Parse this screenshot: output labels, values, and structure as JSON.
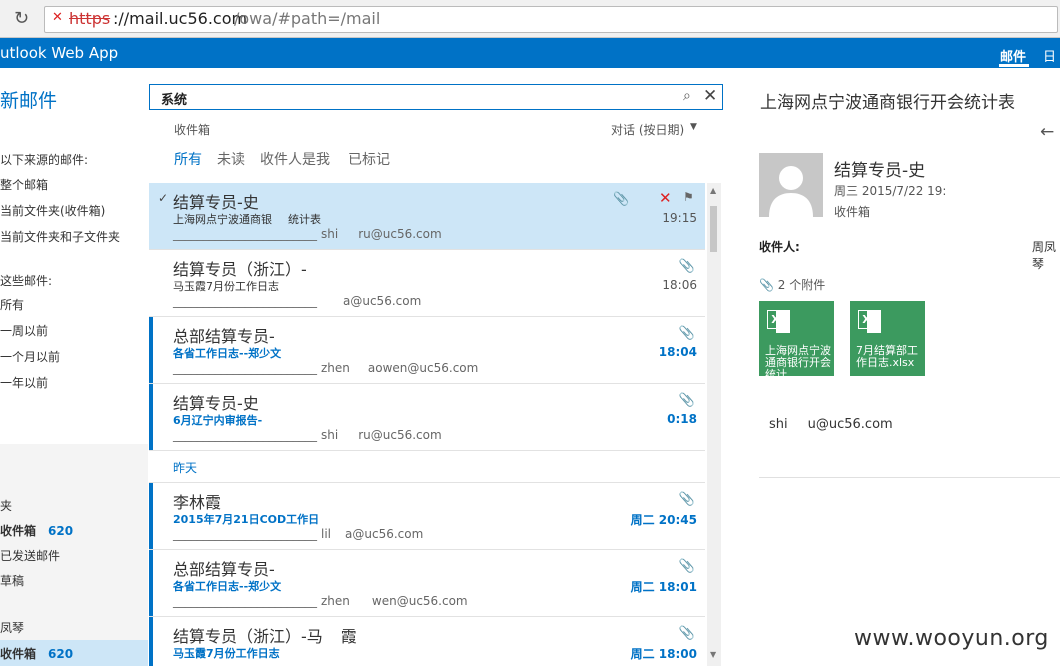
{
  "browser": {
    "url_scheme": "https",
    "url_host": "://mail.uc56.com",
    "url_path": "/owa/#path=/mail"
  },
  "suite": {
    "app_title": "utlook Web App",
    "nav_mail": "邮件",
    "nav_calendar": "日历"
  },
  "left": {
    "new_mail": "新邮件",
    "search_from_label": "以下来源的邮件:",
    "scope_1": "整个邮箱",
    "scope_2": "当前文件夹(收件箱)",
    "scope_3": "当前文件夹和子文件夹",
    "period_label": "这些邮件:",
    "period_1": "所有",
    "period_2": "一周以前",
    "period_3": "一个月以前",
    "period_4": "一年以前",
    "folders_label": "夹",
    "inbox_label": "收件箱",
    "inbox_count": "620",
    "sent_label": "已发送邮件",
    "drafts_label": "草稿",
    "user_label": "凤琴",
    "inbox2_label": "收件箱",
    "inbox2_count": "620"
  },
  "search": {
    "query": "系统"
  },
  "list": {
    "folder": "收件箱",
    "sort": "对话 (按日期)",
    "filters": [
      "所有",
      "未读",
      "收件人是我",
      "已标记"
    ],
    "group_yesterday": "昨天",
    "rows": [
      {
        "sender": "结算专员-史",
        "subject": "上海网点宁波通商银",
        "subject2": "统计表",
        "preview": "shi",
        "preview2": "ru@uc56.com",
        "time": "19:15"
      },
      {
        "sender": "结算专员（浙江）-",
        "subject": "马玉霞7月份工作日志",
        "preview": "a@uc56.com",
        "time": "18:06"
      },
      {
        "sender": "总部结算专员-",
        "subject": "各省工作日志--郑少文",
        "preview": "zhen",
        "preview2": "aowen@uc56.com",
        "time": "18:04"
      },
      {
        "sender": "结算专员-史",
        "subject": "6月辽宁内审报告-",
        "preview": "shi",
        "preview2": "ru@uc56.com",
        "time": "0:18"
      },
      {
        "sender": "李林霞",
        "subject": "2015年7月21日COD工作日",
        "preview": "lil",
        "preview2": "a@uc56.com",
        "time": "周二 20:45"
      },
      {
        "sender": "总部结算专员-",
        "subject": "各省工作日志--郑少文",
        "preview": "zhen",
        "preview2": "wen@uc56.com",
        "time": "周二 18:01"
      },
      {
        "sender": "结算专员（浙江）-马",
        "sender2": "霞",
        "subject": "马玉霞7月份工作日志",
        "preview": "",
        "time": "周二 18:00"
      }
    ]
  },
  "reading": {
    "subject": "上海网点宁波通商银行开会统计表",
    "sender": "结算专员-史",
    "date": "周三 2015/7/22 19:",
    "folder": "收件箱",
    "to_label": "收件人:",
    "to_extra": "周凤琴",
    "attach_count": "2 个附件",
    "attachments": [
      "上海网点宁波通商银行开会统计",
      "7月结算部工作日志.xlsx"
    ],
    "body_1": "shi",
    "body_2": "u@uc56.com"
  },
  "watermark": "www.wooyun.org",
  "colors": {
    "accent": "#0072c6",
    "selected": "#cde6f7",
    "excel": "#3c9a5f",
    "delete": "#dd2222"
  }
}
